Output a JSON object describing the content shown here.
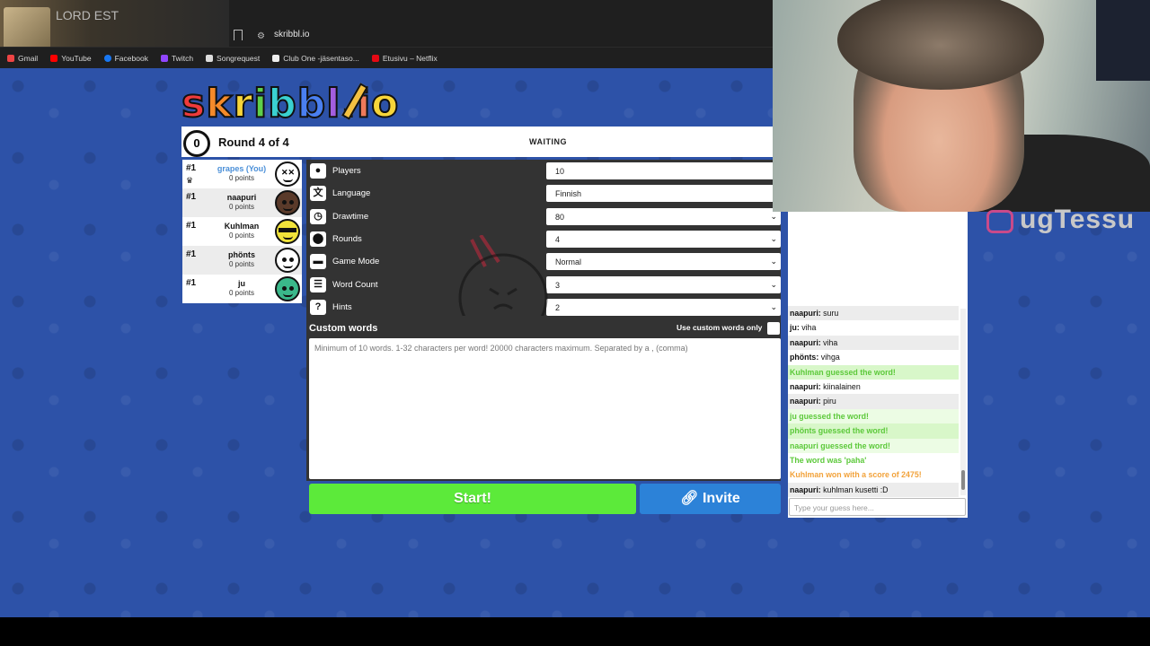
{
  "browser": {
    "tab_title": "LORD EST",
    "url": "skribbl.io",
    "bookmarks": [
      "Gmail",
      "YouTube",
      "Facebook",
      "Twitch",
      "Songrequest",
      "Club One -jäsentaso...",
      "Etusivu – Netflix"
    ]
  },
  "logo": "skribbl.io",
  "topbar": {
    "clock_value": "0",
    "round_text": "Round 4 of 4",
    "status": "WAITING"
  },
  "players": [
    {
      "rank": "#1",
      "name": "grapes (You)",
      "points": "0 points",
      "color": "#ffffff"
    },
    {
      "rank": "#1",
      "name": "naapuri",
      "points": "0 points",
      "color": "#5a3a2a"
    },
    {
      "rank": "#1",
      "name": "Kuhlman",
      "points": "0 points",
      "color": "#f2e33a"
    },
    {
      "rank": "#1",
      "name": "phönts",
      "points": "0 points",
      "color": "#ffffff"
    },
    {
      "rank": "#1",
      "name": "ju",
      "points": "0 points",
      "color": "#3ab88a"
    }
  ],
  "settings": {
    "players_label": "Players",
    "players_value": "10",
    "language_label": "Language",
    "language_value": "Finnish",
    "drawtime_label": "Drawtime",
    "drawtime_value": "80",
    "rounds_label": "Rounds",
    "rounds_value": "4",
    "gamemode_label": "Game Mode",
    "gamemode_value": "Normal",
    "wordcount_label": "Word Count",
    "wordcount_value": "3",
    "hints_label": "Hints",
    "hints_value": "2",
    "custom_words_label": "Custom words",
    "use_custom_label": "Use custom words only",
    "custom_words_placeholder": "Minimum of 10 words. 1-32 characters per word! 20000 characters maximum. Separated by a , (comma)"
  },
  "buttons": {
    "start": "Start!",
    "invite": "Invite"
  },
  "chat": {
    "messages": [
      {
        "user": "naapuri:",
        "text": " suru",
        "style": "alt"
      },
      {
        "user": "ju:",
        "text": " viha",
        "style": ""
      },
      {
        "user": "naapuri:",
        "text": " viha",
        "style": "alt"
      },
      {
        "user": "phönts:",
        "text": " vihga",
        "style": ""
      },
      {
        "user": "",
        "text": "Kuhlman guessed the word!",
        "style": "green bg"
      },
      {
        "user": "naapuri:",
        "text": " kiinalainen",
        "style": ""
      },
      {
        "user": "naapuri:",
        "text": " piru",
        "style": "alt"
      },
      {
        "user": "",
        "text": "ju guessed the word!",
        "style": "green bg2"
      },
      {
        "user": "",
        "text": "phönts guessed the word!",
        "style": "green bg"
      },
      {
        "user": "",
        "text": "naapuri guessed the word!",
        "style": "green bg2"
      },
      {
        "user": "",
        "text": "The word was 'paha'",
        "style": "green"
      },
      {
        "user": "",
        "text": "Kuhlman won with a score of 2475!",
        "style": "orange"
      },
      {
        "user": "naapuri:",
        "text": " kuhlman kusetti :D",
        "style": "alt"
      }
    ],
    "input_placeholder": "Type your guess here..."
  },
  "stream_overlay": {
    "handle": "ugTessu"
  },
  "colors": {
    "background": "#2d52a8",
    "start_button": "#5cea3a",
    "invite_button": "#2c82d8",
    "guess_green": "#5cc93a",
    "win_orange": "#f2a23a"
  }
}
